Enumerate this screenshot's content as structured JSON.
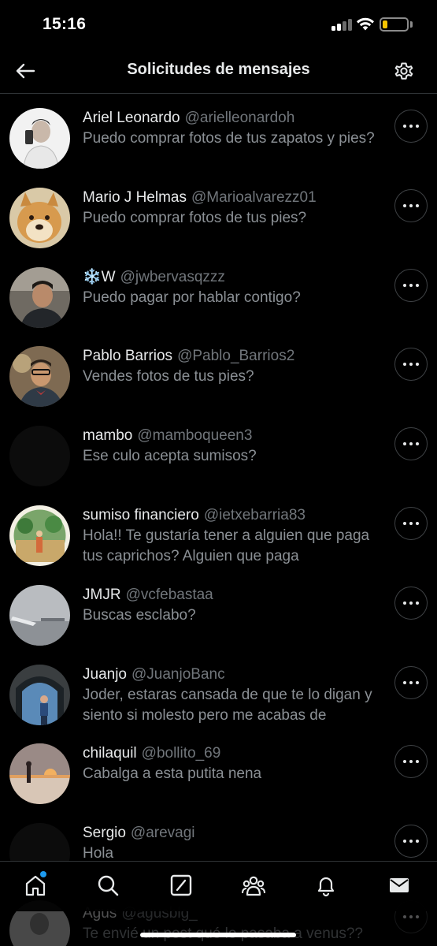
{
  "status_bar": {
    "time": "15:16",
    "battery_level": 0.2,
    "battery_color": "#f5c400"
  },
  "header": {
    "title": "Solicitudes de mensajes",
    "back_icon": "arrow-left-icon",
    "settings_icon": "gear-icon"
  },
  "requests": [
    {
      "name": "Ariel Leonardo",
      "handle": "@arielleonardoh",
      "preview": "Puedo comprar fotos de tus zapatos y pies?"
    },
    {
      "name": "Mario J Helmas",
      "handle": "@Marioalvarezz01",
      "preview": "Puedo comprar fotos de tus pies?"
    },
    {
      "name": "❄️W",
      "handle": "@jwbervasqzzz",
      "preview": "Puedo pagar por hablar contigo?"
    },
    {
      "name": "Pablo Barrios",
      "handle": "@Pablo_Barrios2",
      "preview": "Vendes fotos de tus pies?"
    },
    {
      "name": "mambo",
      "handle": "@mamboqueen3",
      "preview": "Ese culo acepta sumisos?"
    },
    {
      "name": "sumiso financiero",
      "handle": "@ietxebarria83",
      "preview": "Hola!! Te gustaría tener a alguien que paga tus caprichos? Alguien que paga"
    },
    {
      "name": "JMJR",
      "handle": "@vcfebastaa",
      "preview": "Buscas esclabo?"
    },
    {
      "name": "Juanjo",
      "handle": "@JuanjoBanc",
      "preview": "Joder, estaras cansada de que te lo digan y siento si molesto pero me acabas de"
    },
    {
      "name": "chilaquil",
      "handle": "@bollito_69",
      "preview": "Cabalga a esta putita nena"
    },
    {
      "name": "Sergio",
      "handle": "@arevagi",
      "preview": "Hola"
    }
  ],
  "partial_request": {
    "name": "Agus",
    "handle": "@agusblg_",
    "preview": "Te envié un post qué lo pasaba a venus??"
  },
  "tab_bar": {
    "items": [
      "home-icon",
      "search-icon",
      "grok-icon",
      "communities-icon",
      "notifications-icon",
      "messages-icon"
    ],
    "accent_color": "#1d9bf0"
  }
}
